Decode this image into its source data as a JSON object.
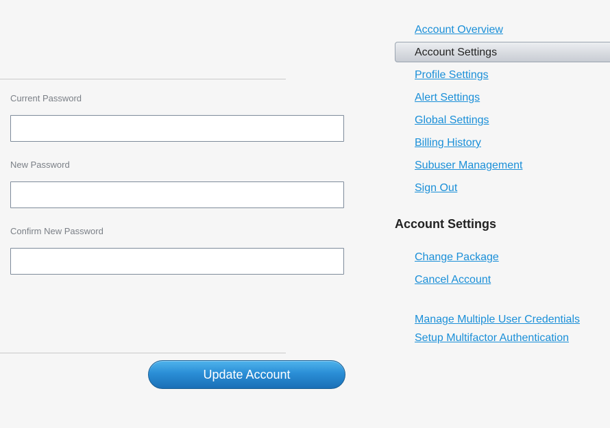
{
  "form": {
    "current_password_label": "Current Password",
    "new_password_label": "New Password",
    "confirm_password_label": "Confirm New Password",
    "update_button_label": "Update Account"
  },
  "nav": {
    "account_overview": "Account Overview",
    "account_settings_active": "Account Settings",
    "profile_settings": "Profile Settings",
    "alert_settings": "Alert Settings",
    "global_settings": "Global Settings",
    "billing_history": "Billing History",
    "subuser_management": "Subuser Management",
    "sign_out": "Sign Out"
  },
  "account_section": {
    "heading": "Account Settings",
    "change_package": "Change Package",
    "cancel_account": "Cancel Account",
    "manage_credentials": "Manage Multiple User Credentials",
    "setup_mfa": "Setup Multifactor Authentication"
  },
  "colors": {
    "link": "#1a8fd8",
    "button": "#2a8ed6",
    "background": "#f6f6f6"
  }
}
